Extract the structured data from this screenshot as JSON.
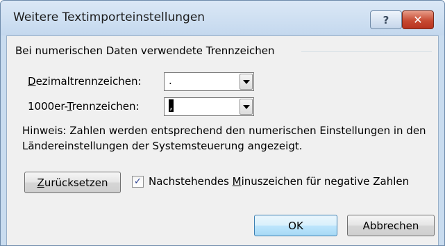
{
  "window": {
    "title": "Weitere Textimporteinstellungen",
    "help_glyph": "?",
    "close_glyph": "✕"
  },
  "group": {
    "label": "Bei numerischen Daten verwendete Trennzeichen"
  },
  "decimal": {
    "label_mnemonic": "D",
    "label_rest": "ezimaltrennzeichen:",
    "value": "."
  },
  "thousands": {
    "label_pre": "1000er-",
    "label_mnemonic": "T",
    "label_rest": "rennzeichen:",
    "value": ","
  },
  "hint": "Hinweis: Zahlen werden entsprechend den numerischen Einstellungen in den Ländereinstellungen der Systemsteuerung angezeigt.",
  "reset_button": {
    "mnemonic": "Z",
    "rest": "urücksetzen"
  },
  "trailing_minus": {
    "checked": true,
    "check_glyph": "✓",
    "label_pre": "Nachstehendes ",
    "label_mnemonic": "M",
    "label_rest": "inuszeichen für negative Zahlen"
  },
  "ok_label": "OK",
  "cancel_label": "Abbrechen",
  "colors": {
    "title_bar": "#c4d8ee",
    "close_button": "#c74a32",
    "ok_button": "#bee6fd"
  }
}
